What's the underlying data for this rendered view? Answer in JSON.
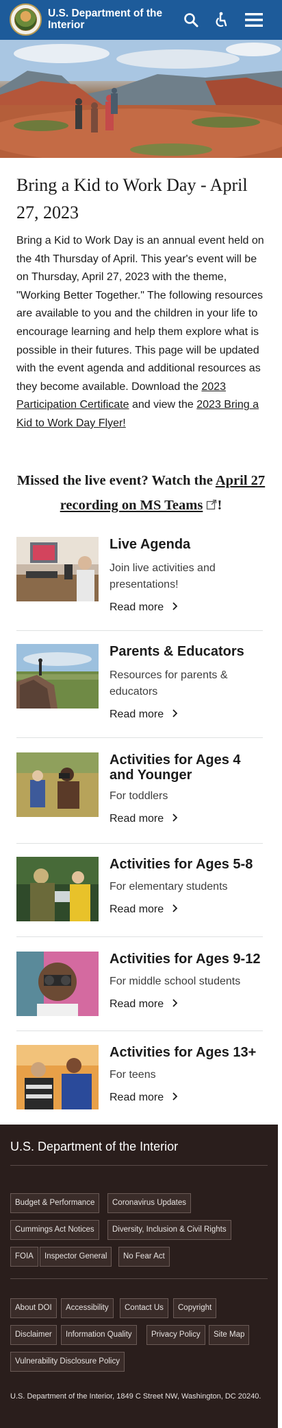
{
  "header": {
    "title_line1": "U.S. Department of the",
    "title_line2": "Interior",
    "icons": [
      "search-icon",
      "accessibility-icon",
      "menu-icon"
    ]
  },
  "page": {
    "title": "Bring a Kid to Work Day - April 27, 2023",
    "intro_text": "Bring a Kid to Work Day is an annual event held on the 4th Thursday of April. This year's event will be on Thursday, April 27, 2023 with the theme, \"Working Better Together.\" The following resources are available to you and the children in your life to encourage learning and help them explore what is possible in their futures. This page will be updated with the event agenda and additional resources as they become available. Download the ",
    "certificate_link": "2023 Participation Certificate",
    "intro_mid": " and view the ",
    "flyer_link": "2023 Bring a Kid to Work Day Flyer!",
    "missed_text": "Missed the live event? Watch the ",
    "missed_link": "April 27 recording on MS Teams",
    "missed_end": "!"
  },
  "cards": [
    {
      "title": "Live Agenda",
      "description": "Join live activities and presentations!",
      "more": "Read more"
    },
    {
      "title": "Parents & Educators",
      "description": "Resources for parents & educators",
      "more": "Read more"
    },
    {
      "title": "Activities for Ages 4 and Younger",
      "description": "For toddlers",
      "more": "Read more"
    },
    {
      "title": "Activities for Ages 5-8",
      "description": "For elementary students",
      "more": "Read more"
    },
    {
      "title": "Activities for Ages 9-12",
      "description": "For middle school students",
      "more": "Read more"
    },
    {
      "title": "Activities for Ages 13+",
      "description": "For teens",
      "more": "Read more"
    }
  ],
  "footer": {
    "title": "U.S. Department of the Interior",
    "links_group1": [
      "Budget & Performance",
      "Coronavirus Updates",
      "Cummings Act Notices",
      "Diversity, Inclusion & Civil Rights",
      "FOIA",
      "Inspector General",
      "No Fear Act"
    ],
    "links_group2": [
      "About DOI",
      "Accessibility",
      "Contact Us",
      "Copyright",
      "Disclaimer",
      "Information Quality",
      "Privacy Policy",
      "Site Map",
      "Vulnerability Disclosure Policy"
    ],
    "address": "U.S. Department of the Interior, 1849 C Street NW, Washington, DC 20240."
  },
  "colors": {
    "header_bg": "#1d5b9a",
    "footer_bg": "#2a1e1c"
  }
}
